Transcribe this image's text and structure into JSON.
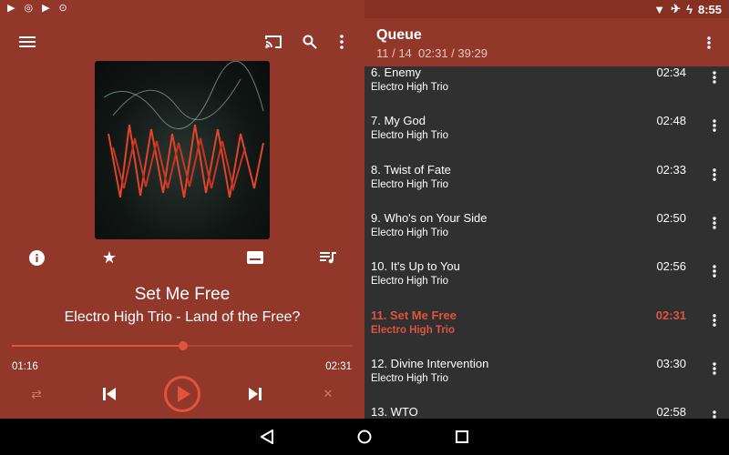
{
  "status_bar": {
    "time": "8:55",
    "left_icons": [
      "play-store-icon",
      "sync-icon",
      "play-store-icon",
      "record-icon"
    ],
    "right_icons": [
      "wifi-icon",
      "airplane-icon",
      "battery-charging-icon"
    ]
  },
  "player": {
    "toolbar_icons": [
      "menu-icon",
      "cast-icon",
      "search-icon",
      "more-vert-icon"
    ],
    "action_icons": [
      "info-icon",
      "star-icon",
      "lyrics-icon",
      "playlist-icon"
    ],
    "song_title": "Set Me Free",
    "song_subtitle": "Electro High Trio - Land of the Free?",
    "elapsed": "01:16",
    "duration": "02:31",
    "progress": 0.503,
    "controls": [
      "repeat-icon",
      "previous-icon",
      "play-icon",
      "next-icon",
      "shuffle-icon"
    ]
  },
  "queue": {
    "title": "Queue",
    "position": "11 / 14",
    "times": "02:31 / 39:29",
    "items": [
      {
        "title": "6. Enemy",
        "artist": "Electro High Trio",
        "duration": "02:34"
      },
      {
        "title": "7. My God",
        "artist": "Electro High Trio",
        "duration": "02:48"
      },
      {
        "title": "8. Twist of Fate",
        "artist": "Electro High Trio",
        "duration": "02:33"
      },
      {
        "title": "9. Who's on Your Side",
        "artist": "Electro High Trio",
        "duration": "02:50"
      },
      {
        "title": "10. It's Up to You",
        "artist": "Electro High Trio",
        "duration": "02:56"
      },
      {
        "title": "11. Set Me Free",
        "artist": "Electro High Trio",
        "duration": "02:31",
        "current": true
      },
      {
        "title": "12. Divine Intervention",
        "artist": "Electro High Trio",
        "duration": "03:30"
      },
      {
        "title": "13. WTO",
        "artist": "",
        "duration": "02:58"
      }
    ]
  },
  "colors": {
    "primary": "#92382a",
    "accent": "#e0533c",
    "list_bg": "#303030"
  }
}
